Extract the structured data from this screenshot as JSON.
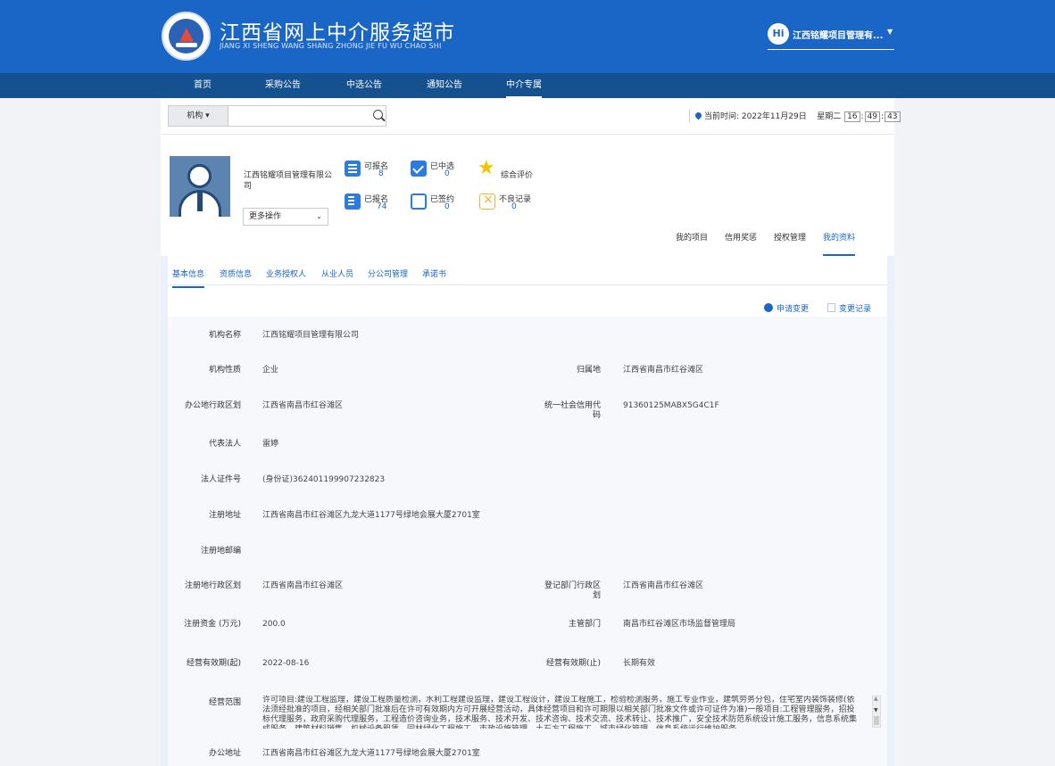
{
  "header": {
    "title": "江西省网上中介服务超市",
    "subtitle": "JIANG XI SHENG WANG SHANG ZHONG JIE FU WU CHAO SHI",
    "user_hi": "Hi",
    "user_name": "江西铭耀项目管理有...",
    "user_caret": "▼"
  },
  "nav": {
    "items": [
      "首页",
      "采购公告",
      "中选公告",
      "通知公告",
      "中介专属"
    ],
    "active": "中介专属"
  },
  "search": {
    "select_label": "机构 ▾",
    "placeholder": ""
  },
  "time": {
    "label": "当前时间:",
    "date": "2022年11月29日",
    "weekday": "星期二",
    "hh": "16",
    "mm": "49",
    "ss": "43",
    "sep": ":"
  },
  "profile": {
    "org_name": "江西铭耀项目管理有限公司",
    "more_ops": "更多操作",
    "more_ops_caret": "⌄",
    "stats": [
      {
        "label": "可报名",
        "value": "8"
      },
      {
        "label": "已中选",
        "value": "0"
      },
      {
        "label": "综合评价",
        "value": ""
      },
      {
        "label": "已报名",
        "value": "74"
      },
      {
        "label": "已签约",
        "value": "0"
      },
      {
        "label": "不良记录",
        "value": "0"
      }
    ],
    "star_glyph": "★"
  },
  "sub_tabs": [
    "我的项目",
    "信用奖惩",
    "授权管理",
    "我的资料"
  ],
  "tabs": [
    "基本信息",
    "资质信息",
    "业务授权人",
    "从业人员",
    "分公司管理",
    "承诺书"
  ],
  "actions": {
    "apply_change": "申请变更",
    "change_log": "变更记录"
  },
  "fields": {
    "org_name_label": "机构名称",
    "org_name": "江西铭耀项目管理有限公司",
    "org_type_label": "机构性质",
    "org_type": "企业",
    "belong_label": "归属地",
    "belong": "江西省南昌市红谷滩区",
    "office_region_label": "办公地行政区划",
    "office_region": "江西省南昌市红谷滩区",
    "credit_code_label": "统一社会信用代码",
    "credit_code": "91360125MABX5G4C1F",
    "legal_rep_label": "代表法人",
    "legal_rep": "雷婷",
    "legal_id_label": "法人证件号",
    "legal_id": "(身份证)362401199907232823",
    "reg_addr_label": "注册地址",
    "reg_addr": "江西省南昌市红谷滩区九龙大道1177号绿地会展大厦2701室",
    "reg_zip_label": "注册地邮编",
    "reg_zip": "",
    "reg_region_label": "注册地行政区划",
    "reg_region": "江西省南昌市红谷滩区",
    "reg_dept_label": "登记部门行政区划",
    "reg_dept": "江西省南昌市红谷滩区",
    "capital_label": "注册资金 (万元)",
    "capital": "200.0",
    "authority_label": "主管部门",
    "authority": "南昌市红谷滩区市场监督管理局",
    "valid_from_label": "经营有效期(起)",
    "valid_from": "2022-08-16",
    "valid_to_label": "经营有效期(止)",
    "valid_to": "长期有效",
    "scope_label": "经营范围",
    "scope": "许可项目:建设工程监理，建设工程质量检测，水利工程建设监理，建设工程设计，建设工程施工，检验检测服务，施工专业作业，建筑劳务分包，住宅室内装饰装修(依法须经批准的项目，经相关部门批准后在许可有效期内方可开展经营活动，具体经营项目和许可期限以相关部门批准文件或许可证件为准)一般项目:工程管理服务，招投标代理服务，政府采购代理服务，工程造价咨询业务，技术服务、技术开发、技术咨询、技术交流、技术转让、技术推广，安全技术防范系统设计施工服务，信息系统集成服务，建筑材料销售，机械设备租赁，园林绿化工程施工，市政设施管理，土石方工程施工，城市绿化管理，信息系统运行维护服务",
    "office_addr_label": "办公地址",
    "office_addr": "江西省南昌市红谷滩区九龙大道1177号绿地会展大厦2701室"
  },
  "colors": {
    "brand": "#1a66c7",
    "nav": "#15508f"
  }
}
